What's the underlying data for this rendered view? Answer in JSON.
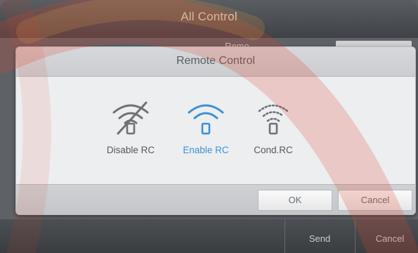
{
  "background_window": {
    "title": "All Control",
    "partial_label": "Remo",
    "bottom_buttons": {
      "send": "Send",
      "cancel": "Cancel"
    }
  },
  "dialog": {
    "title": "Remote Control",
    "options": [
      {
        "label": "Disable RC",
        "icon": "wifi-disabled-icon",
        "selected": false
      },
      {
        "label": "Enable RC",
        "icon": "wifi-enabled-icon",
        "selected": true
      },
      {
        "label": "Cond.RC",
        "icon": "wifi-conditional-icon",
        "selected": false
      }
    ],
    "ok_label": "OK",
    "cancel_label": "Cancel"
  },
  "colors": {
    "accent": "#3e8fd8",
    "icon_gray": "#6d7074",
    "dialog_bg": "#eceef0",
    "header_bg": "#4a4d51"
  }
}
